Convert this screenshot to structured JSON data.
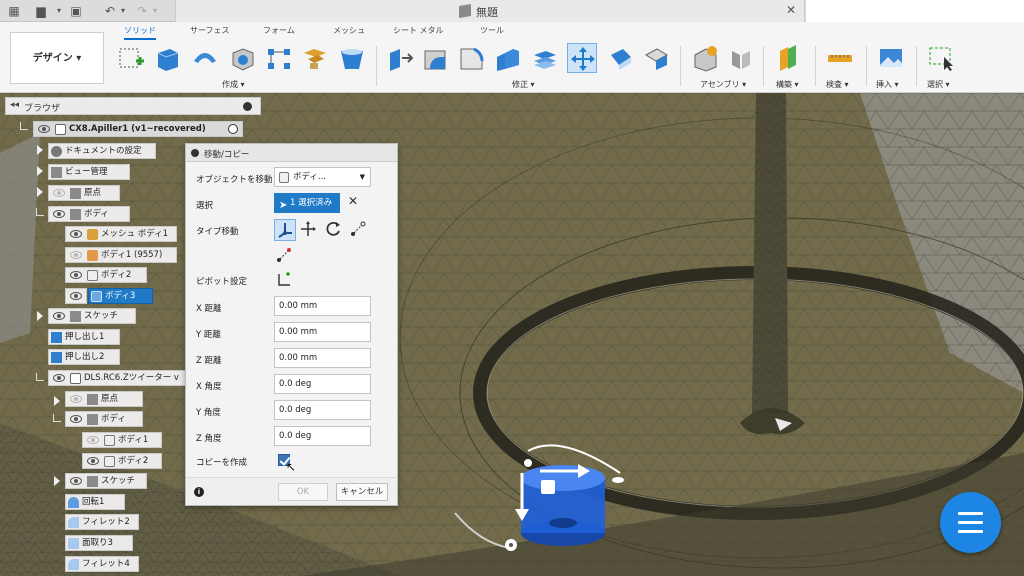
{
  "window": {
    "doc_title": "無題"
  },
  "toolbar": {
    "workspace": "デザイン",
    "tabs": [
      "ソリッド",
      "サーフェス",
      "フォーム",
      "メッシュ",
      "シート メタル",
      "ツール"
    ],
    "active_tab": "ソリッド",
    "groups": {
      "create": "作成",
      "modify": "修正",
      "assemble": "アセンブリ",
      "construct": "構築",
      "inspect": "検査",
      "insert": "挿入",
      "select": "選択"
    }
  },
  "browser": {
    "title": "ブラウザ",
    "nodes": [
      {
        "label": "CX8.Apiller1 (v1~recovered)",
        "kind": "root"
      },
      {
        "label": "ドキュメントの設定",
        "kind": "settings"
      },
      {
        "label": "ビュー管理",
        "kind": "folder"
      },
      {
        "label": "原点",
        "kind": "folder"
      },
      {
        "label": "ボディ",
        "kind": "folder"
      },
      {
        "label": "メッシュ ボディ1",
        "kind": "mesh"
      },
      {
        "label": "ボディ1 (9557)",
        "kind": "body"
      },
      {
        "label": "ボディ2",
        "kind": "body"
      },
      {
        "label": "ボディ3",
        "kind": "body",
        "selected": true
      },
      {
        "label": "スケッチ",
        "kind": "folder"
      },
      {
        "label": "押し出し1",
        "kind": "feature"
      },
      {
        "label": "押し出し2",
        "kind": "feature"
      },
      {
        "label": "DLS.RC6.Zツイーター v",
        "kind": "component"
      },
      {
        "label": "原点",
        "kind": "folder"
      },
      {
        "label": "ボディ",
        "kind": "folder"
      },
      {
        "label": "ボディ1",
        "kind": "body"
      },
      {
        "label": "ボディ2",
        "kind": "body"
      },
      {
        "label": "スケッチ",
        "kind": "folder"
      },
      {
        "label": "回転1",
        "kind": "feature"
      },
      {
        "label": "フィレット2",
        "kind": "feature"
      },
      {
        "label": "面取り3",
        "kind": "feature"
      },
      {
        "label": "フィレット4",
        "kind": "feature"
      }
    ]
  },
  "dialog": {
    "title": "移動/コピー",
    "object_label": "オブジェクトを移動",
    "object_value": "ボディ...",
    "selection_label": "選択",
    "selection_value": "1 選択済み",
    "move_type_label": "タイプ移動",
    "pivot_label": "ピボット設定",
    "x_dist_label": "X 距離",
    "x_dist": "0.00 mm",
    "y_dist_label": "Y 距離",
    "y_dist": "0.00 mm",
    "z_dist_label": "Z 距離",
    "z_dist": "0.00 mm",
    "x_angle_label": "X 角度",
    "x_angle": "0.0 deg",
    "y_angle_label": "Y 角度",
    "y_angle": "0.0 deg",
    "z_angle_label": "Z 角度",
    "z_angle": "0.0 deg",
    "copy_label": "コピーを作成",
    "copy_checked": true,
    "ok": "OK",
    "cancel": "キャンセル"
  },
  "colors": {
    "accent": "#1f7bc7",
    "mesh_fill": "#7a7350",
    "fab": "#1d86e4",
    "body3": "#1f5fd8"
  },
  "icons": [
    "grid-icon",
    "file-icon",
    "save-icon",
    "undo-icon",
    "redo-icon",
    "close-icon",
    "info-icon",
    "hamburger-icon"
  ]
}
